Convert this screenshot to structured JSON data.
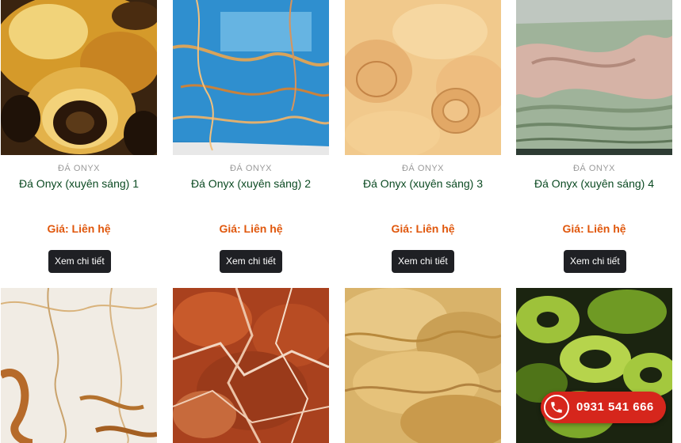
{
  "products": [
    {
      "category": "ĐÁ ONYX",
      "name": "Đá Onyx (xuyên sáng) 1",
      "price_label": "Giá: Liên hệ",
      "button": "Xem chi tiết"
    },
    {
      "category": "ĐÁ ONYX",
      "name": "Đá Onyx (xuyên sáng) 2",
      "price_label": "Giá: Liên hệ",
      "button": "Xem chi tiết"
    },
    {
      "category": "ĐÁ ONYX",
      "name": "Đá Onyx (xuyên sáng) 3",
      "price_label": "Giá: Liên hệ",
      "button": "Xem chi tiết"
    },
    {
      "category": "ĐÁ ONYX",
      "name": "Đá Onyx (xuyên sáng) 4",
      "price_label": "Giá: Liên hệ",
      "button": "Xem chi tiết"
    }
  ],
  "hotline": {
    "number": "0931 541 666",
    "icon": "phone-icon"
  },
  "colors": {
    "title": "#0b4a22",
    "price": "#e0570c",
    "button_bg": "#1f2024",
    "hotline_bg": "#d6261c",
    "category": "#9a9a9a"
  }
}
